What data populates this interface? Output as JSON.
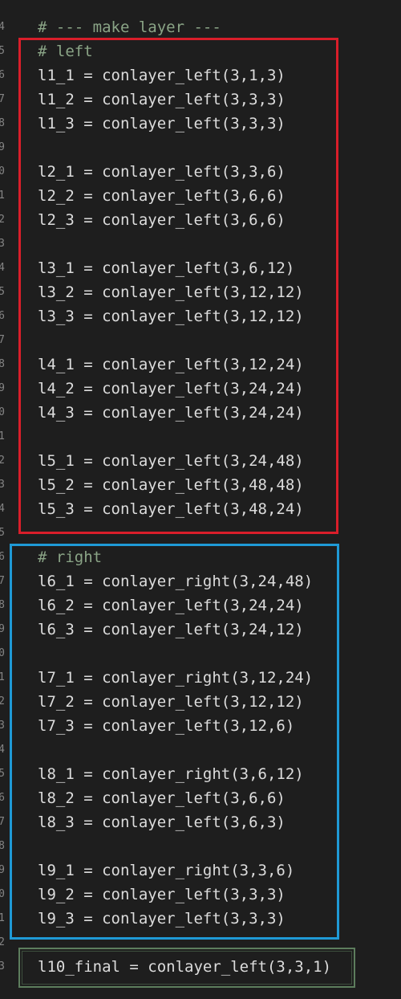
{
  "editor": {
    "header_comment": "# --- make layer ---",
    "gutter_numbers": [
      "4",
      "5",
      "6",
      "7",
      "8",
      "9",
      "0",
      "1",
      "2",
      "3",
      "4",
      "5",
      "6",
      "7",
      "8",
      "9",
      "0",
      "1",
      "2",
      "3",
      "4",
      "5",
      "6",
      "7",
      "8",
      "9",
      "0",
      "1",
      "2",
      "3",
      "4",
      "5",
      "6",
      "7",
      "8",
      "9",
      "0",
      "1",
      "2",
      "3"
    ],
    "left_section": {
      "comment": "# left",
      "lines": [
        "l1_1 = conlayer_left(3,1,3)",
        "l1_2 = conlayer_left(3,3,3)",
        "l1_3 = conlayer_left(3,3,3)",
        "",
        "l2_1 = conlayer_left(3,3,6)",
        "l2_2 = conlayer_left(3,6,6)",
        "l2_3 = conlayer_left(3,6,6)",
        "",
        "l3_1 = conlayer_left(3,6,12)",
        "l3_2 = conlayer_left(3,12,12)",
        "l3_3 = conlayer_left(3,12,12)",
        "",
        "l4_1 = conlayer_left(3,12,24)",
        "l4_2 = conlayer_left(3,24,24)",
        "l4_3 = conlayer_left(3,24,24)",
        "",
        "l5_1 = conlayer_left(3,24,48)",
        "l5_2 = conlayer_left(3,48,48)",
        "l5_3 = conlayer_left(3,48,24)"
      ]
    },
    "right_section": {
      "comment": "# right",
      "lines": [
        "l6_1 = conlayer_right(3,24,48)",
        "l6_2 = conlayer_left(3,24,24)",
        "l6_3 = conlayer_left(3,24,12)",
        "",
        "l7_1 = conlayer_right(3,12,24)",
        "l7_2 = conlayer_left(3,12,12)",
        "l7_3 = conlayer_left(3,12,6)",
        "",
        "l8_1 = conlayer_right(3,6,12)",
        "l8_2 = conlayer_left(3,6,6)",
        "l8_3 = conlayer_left(3,6,3)",
        "",
        "l9_1 = conlayer_right(3,3,6)",
        "l9_2 = conlayer_left(3,3,3)",
        "l9_3 = conlayer_left(3,3,3)"
      ]
    },
    "final_line": "l10_final = conlayer_left(3,3,1)"
  },
  "colors": {
    "background": "#1e1e1e",
    "text": "#dcdcdc",
    "comment": "#8aa486",
    "left_box": "#d91e2a",
    "right_box": "#1f9ad6",
    "final_box": "#5d7d5d"
  }
}
